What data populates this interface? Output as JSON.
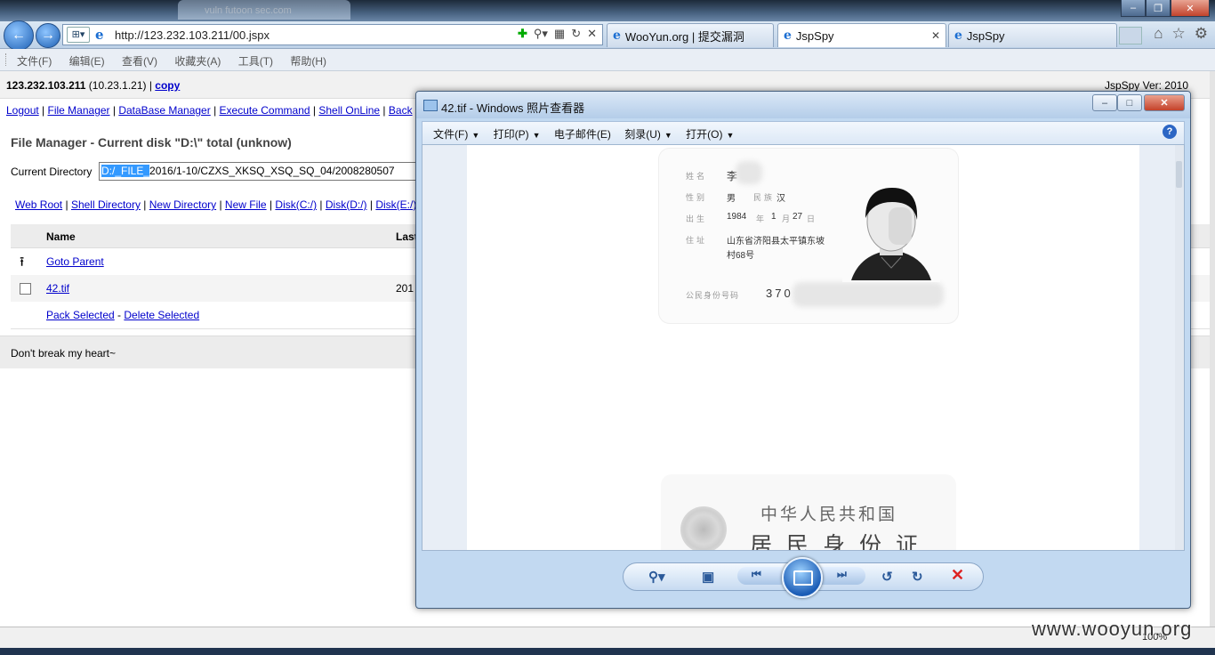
{
  "browser": {
    "faded_tab_text": "vuln futoon sec.com",
    "url": "http://123.232.103.211/00.jspx",
    "tabs": [
      {
        "label": "WooYun.org | 提交漏洞"
      },
      {
        "label": "JspSpy"
      },
      {
        "label": "JspSpy"
      }
    ],
    "menu": [
      "文件(F)",
      "编辑(E)",
      "查看(V)",
      "收藏夹(A)",
      "工具(T)",
      "帮助(H)"
    ],
    "zoom": "100%"
  },
  "page": {
    "host_ip": "123.232.103.211",
    "host_inner": "(10.23.1.21)",
    "sep": " | ",
    "copy_label": "copy",
    "version": "JspSpy Ver: 2010",
    "nav_links": [
      "Logout",
      "File Manager",
      "DataBase Manager",
      "Execute Command",
      "Shell OnLine",
      "Back"
    ],
    "title": "File Manager - Current disk \"D:\\\" total (unknow)",
    "current_dir_label": "Current Directory",
    "current_dir_selected": "D:/_FILE_",
    "current_dir_rest": "2016/1-10/CZXS_XKSQ_XSQ_SQ_04/2008280507",
    "shortcuts": [
      "Web Root",
      "Shell Directory",
      "New Directory",
      "New File",
      "Disk(C:/)",
      "Disk(D:/)",
      "Disk(E:/)"
    ],
    "col_name": "Name",
    "col_last": "Last",
    "goto_parent": "Goto Parent",
    "file_name": "42.tif",
    "file_date": "201",
    "pack_selected": "Pack Selected",
    "dash": " - ",
    "delete_selected": "Delete Selected",
    "footer": "Don't break my heart~"
  },
  "viewer": {
    "title": "42.tif - Windows 照片查看器",
    "menu": [
      "文件(F)",
      "打印(P)",
      "电子邮件(E)",
      "刻录(U)",
      "打开(O)"
    ],
    "help": "?",
    "id_card": {
      "name_label": "姓名",
      "name_value": "李",
      "sex_label": "性别",
      "sex_value": "男",
      "nation_label": "民族",
      "nation_value": "汉",
      "birth_label": "出生",
      "birth_year": "1984",
      "year_char": "年",
      "birth_month": "1",
      "month_char": "月",
      "birth_day": "27",
      "day_char": "日",
      "addr_label": "住址",
      "addr_line1": "山东省济阳县太平镇东坡",
      "addr_line2": "村68号",
      "id_label": "公民身份号码",
      "id_value": "370",
      "back_line1": "中华人民共和国",
      "back_line2": "居民身份证"
    }
  },
  "watermark": "www.wooyun.org",
  "colors": {
    "link": "#0000cc",
    "selection": "#3399ff",
    "viewer_bg": "#c2d9f1"
  }
}
